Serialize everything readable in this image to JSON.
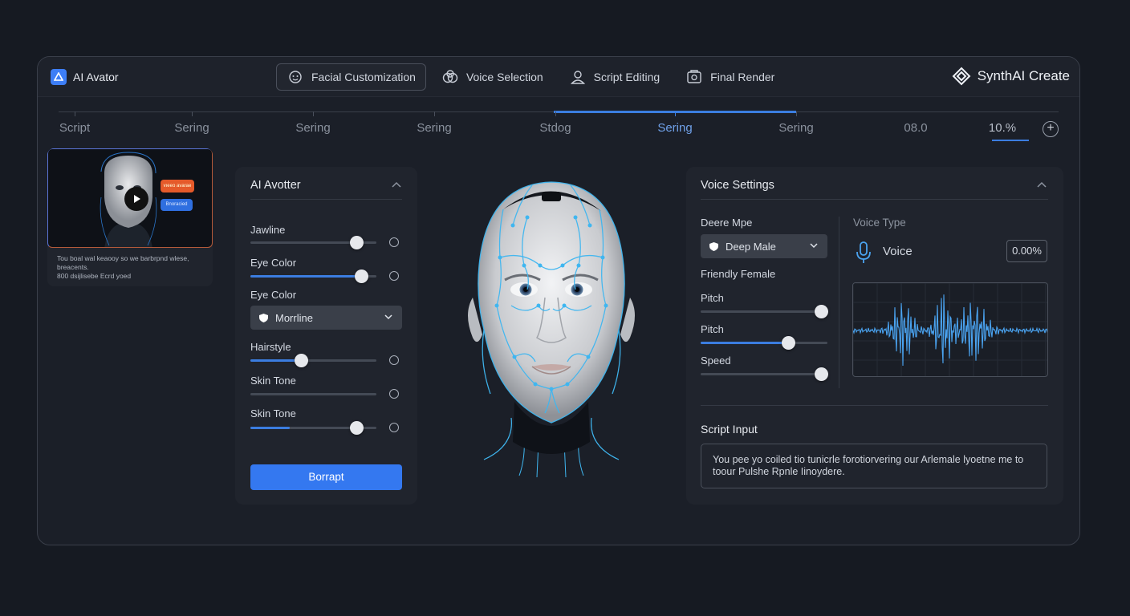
{
  "app": {
    "title": "AI Avator",
    "brand": "SynthAI Create"
  },
  "tabs": [
    {
      "label": "Facial Customization",
      "icon": "face-icon",
      "active": true
    },
    {
      "label": "Voice Selection",
      "icon": "voice-selection-icon",
      "active": false
    },
    {
      "label": "Script Editing",
      "icon": "user-icon",
      "active": false
    },
    {
      "label": "Final Render",
      "icon": "render-icon",
      "active": false
    }
  ],
  "timeline": {
    "items": [
      "Script",
      "Sering",
      "Sering",
      "Sering",
      "Stdog",
      "Sering",
      "Sering",
      "08.0",
      "10.%"
    ],
    "active_index": 5
  },
  "preview": {
    "bubble_top": "vıeeo avarae",
    "bubble_bottom": "Bnoracied",
    "caption_line1": "Tou boal wal keaooy so we barbrpnd wlese,",
    "caption_line2": "breacents.",
    "caption_line3": "800 dsijlisebe Ecrd yoed"
  },
  "avatar_panel": {
    "title": "AI Avotter",
    "controls": [
      {
        "label": "Jawline",
        "type": "slider",
        "value": 0.84,
        "filled": false
      },
      {
        "label": "Eye Color",
        "type": "slider",
        "value": 0.88,
        "filled": true
      },
      {
        "label": "Eye Color",
        "type": "select",
        "selected": "Morrline"
      },
      {
        "label": "Hairstyle",
        "type": "slider",
        "value": 0.4,
        "filled": true
      },
      {
        "label": "Skin Tone",
        "type": "slider",
        "value": null,
        "filled": false
      },
      {
        "label": "Skin Tone",
        "type": "slider",
        "value": 0.84,
        "filled": true,
        "fill_value": 0.31
      }
    ],
    "button": "Borrapt"
  },
  "voice_panel": {
    "title": "Voice Settings",
    "deep_label": "Deere Mpe",
    "deep_select": "Deep Male",
    "friendly": "Friendly Female",
    "sliders": [
      {
        "label": "Pitch",
        "value": 1.0,
        "filled": false
      },
      {
        "label": "Pitch",
        "value": 0.69,
        "filled": true
      },
      {
        "label": "Speed",
        "value": 1.0,
        "filled": false
      }
    ],
    "voice_type_label": "Voice Type",
    "voice_label": "Voice",
    "voice_pct": "0.00%",
    "script_title": "Script Input",
    "script_text": "You pee yo coiled tio tunicrle forotiorvering our Arlemale lyoetne me to toour Pulshe Rpnle Iinoydere."
  },
  "colors": {
    "accent": "#3b7de0",
    "background": "#161a22",
    "panel": "#20242d",
    "face_glow": "#3fb6f0"
  }
}
